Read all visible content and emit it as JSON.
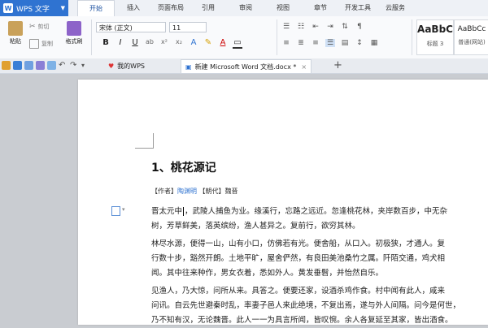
{
  "app": {
    "name": "WPS 文字",
    "logo_letter": "W"
  },
  "menu": [
    "开始",
    "插入",
    "页面布局",
    "引用",
    "审阅",
    "视图",
    "章节",
    "开发工具",
    "云服务"
  ],
  "active_menu": "开始",
  "ribbon": {
    "paste_label": "粘贴",
    "cut_label": "剪切",
    "copy_label": "复制",
    "format_painter_label": "格式刷",
    "font_name": "宋体 (正文)",
    "font_size": "11",
    "styles": [
      {
        "preview": "AaBbC",
        "name": "标题 3"
      },
      {
        "preview": "AaBbCc",
        "name": "普通(网站)"
      }
    ]
  },
  "tabs": [
    {
      "label": "我的WPS",
      "active": false
    },
    {
      "label": "新建 Microsoft Word 文档.docx *",
      "active": true
    }
  ],
  "document": {
    "title": "1、桃花源记",
    "meta_author_tag": "【作者】",
    "meta_author": "陶渊明",
    "meta_dynasty_tag": "【朝代】",
    "meta_dynasty": "魏晋",
    "para1_before_caret": "晋太元中",
    "para1_after_caret": "，武陵人捕鱼为业。缘溪行，忘路之远近。忽逢桃花林，夹岸数百步，中无杂",
    "para1_line2": "树，芳草鲜美，落英缤纷，渔人甚异之。复前行，欲穷其林。",
    "para2_line1": "林尽水源，便得一山，山有小口，仿佛若有光。便舍船，从口入。初极狭，才通人。复",
    "para2_line2": "行数十步，豁然开朗。土地平旷，屋舍俨然，有良田美池桑竹之属。阡陌交通，鸡犬相",
    "para2_line3": "闻。其中往来种作，男女衣着，悉如外人。黄发垂髫，并怡然自乐。",
    "para3_line1": "见渔人，乃大惊，问所从来。具答之。便要还家，设酒杀鸡作食。村中闻有此人，咸来",
    "para3_line2": "问讯。自云先世避秦时乱，率妻子邑人来此绝境，不复出焉，遂与外人间隔。问今是何世，",
    "para3_line3": "乃不知有汉，无论魏晋。此人一一为具言所闻，皆叹惋。余人各复延至其家，皆出酒食。"
  },
  "colors": {
    "accent": "#2f73d1",
    "active_tab_text": "#1a4f9f",
    "author_link": "#2a6fcf"
  }
}
